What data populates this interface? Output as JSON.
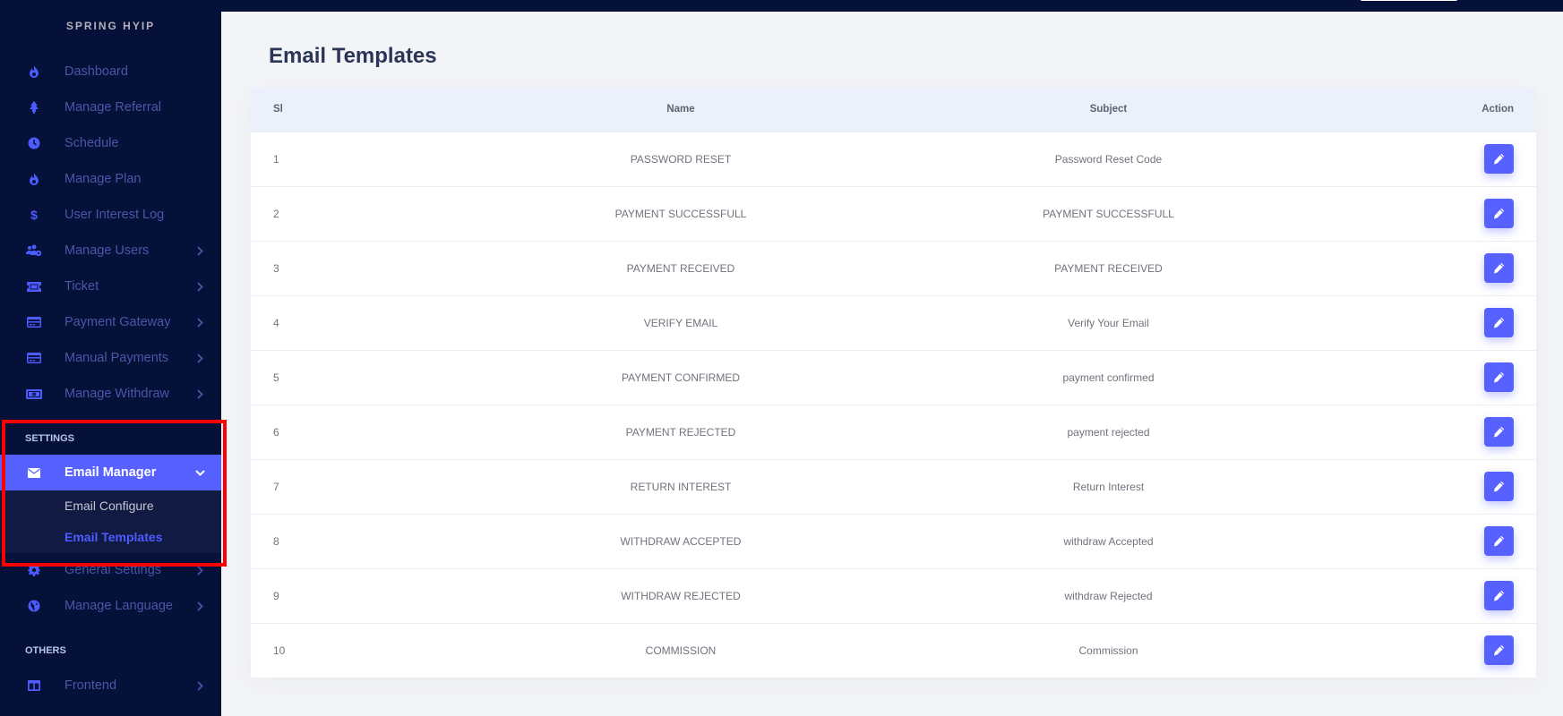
{
  "brand": "SPRING HYIP",
  "sidebar": {
    "items": [
      {
        "label": "Dashboard",
        "icon": "fire-icon",
        "has_submenu": false
      },
      {
        "label": "Manage Referral",
        "icon": "tree-icon",
        "has_submenu": false
      },
      {
        "label": "Schedule",
        "icon": "clock-icon",
        "has_submenu": false
      },
      {
        "label": "Manage Plan",
        "icon": "fire-icon",
        "has_submenu": false
      },
      {
        "label": "User Interest Log",
        "icon": "dollar-icon",
        "has_submenu": false
      },
      {
        "label": "Manage Users",
        "icon": "users-cog-icon",
        "has_submenu": true
      },
      {
        "label": "Ticket",
        "icon": "ticket-icon",
        "has_submenu": true
      },
      {
        "label": "Payment Gateway",
        "icon": "credit-card-icon",
        "has_submenu": true
      },
      {
        "label": "Manual Payments",
        "icon": "credit-card-icon",
        "has_submenu": true
      },
      {
        "label": "Manage Withdraw",
        "icon": "money-bill-icon",
        "has_submenu": true
      }
    ],
    "settings_title": "SETTINGS",
    "settings_items": [
      {
        "label": "Email Manager",
        "icon": "envelope-icon",
        "has_submenu": true,
        "expanded": true
      },
      {
        "label": "General Settings",
        "icon": "gear-icon",
        "has_submenu": true
      },
      {
        "label": "Manage Language",
        "icon": "globe-icon",
        "has_submenu": true
      }
    ],
    "email_submenu": [
      {
        "label": "Email Configure",
        "active": false
      },
      {
        "label": "Email Templates",
        "active": true
      }
    ],
    "others_title": "OTHERS",
    "others_items": [
      {
        "label": "Frontend",
        "icon": "columns-icon",
        "has_submenu": true
      }
    ]
  },
  "page": {
    "title": "Email Templates"
  },
  "table": {
    "headers": {
      "sl": "Sl",
      "name": "Name",
      "subject": "Subject",
      "action": "Action"
    },
    "rows": [
      {
        "sl": "1",
        "name": "PASSWORD RESET",
        "subject": "Password Reset Code"
      },
      {
        "sl": "2",
        "name": "PAYMENT SUCCESSFULL",
        "subject": "PAYMENT SUCCESSFULL"
      },
      {
        "sl": "3",
        "name": "PAYMENT RECEIVED",
        "subject": "PAYMENT RECEIVED"
      },
      {
        "sl": "4",
        "name": "VERIFY EMAIL",
        "subject": "Verify Your Email"
      },
      {
        "sl": "5",
        "name": "PAYMENT CONFIRMED",
        "subject": "payment confirmed"
      },
      {
        "sl": "6",
        "name": "PAYMENT REJECTED",
        "subject": "payment rejected"
      },
      {
        "sl": "7",
        "name": "RETURN INTEREST",
        "subject": "Return Interest"
      },
      {
        "sl": "8",
        "name": "WITHDRAW ACCEPTED",
        "subject": "withdraw Accepted"
      },
      {
        "sl": "9",
        "name": "WITHDRAW REJECTED",
        "subject": "withdraw Rejected"
      },
      {
        "sl": "10",
        "name": "COMMISSION",
        "subject": "Commission"
      }
    ],
    "action_icon": "pencil-icon"
  },
  "colors": {
    "sidebar_bg": "#06113a",
    "accent": "#5761ff",
    "content_bg": "#f3f4f7",
    "highlight_box": "#ff0000"
  }
}
